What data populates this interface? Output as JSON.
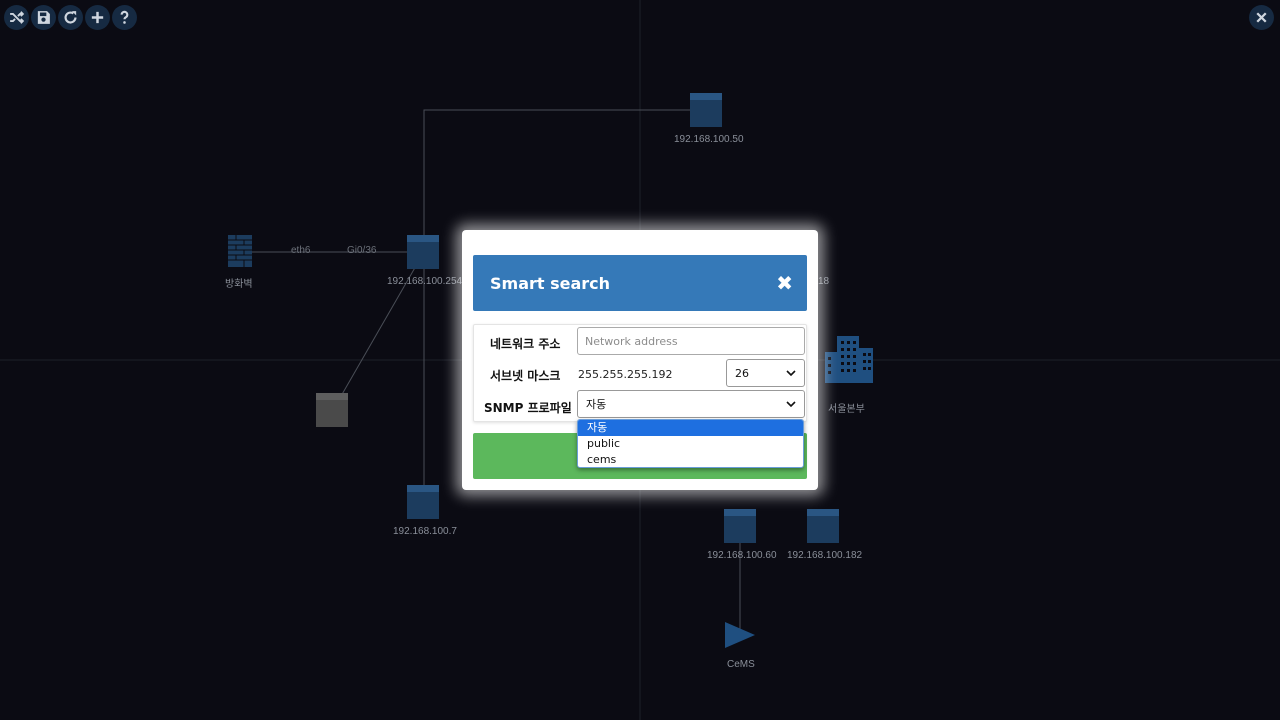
{
  "toolbar": {
    "buttons": [
      {
        "name": "shuffle-icon"
      },
      {
        "name": "save-icon"
      },
      {
        "name": "refresh-icon"
      },
      {
        "name": "plus-icon"
      },
      {
        "name": "help-icon"
      }
    ],
    "close_icon": "close-icon"
  },
  "topology": {
    "nodes": [
      {
        "label": "192.168.100.50",
        "type": "switch"
      },
      {
        "label": "방화벽",
        "type": "firewall"
      },
      {
        "label": "192.168.100.254",
        "type": "switch"
      },
      {
        "label": "18",
        "type": "hidden"
      },
      {
        "label": "",
        "type": "unknown-device"
      },
      {
        "label": "서울본부",
        "type": "building"
      },
      {
        "label": "192.168.100.7",
        "type": "switch"
      },
      {
        "label": "192.168.100.60",
        "type": "switch"
      },
      {
        "label": "192.168.100.182",
        "type": "switch"
      },
      {
        "label": "CeMS",
        "type": "play"
      }
    ],
    "link_labels": {
      "eth": "eth6",
      "gi": "Gi0/36"
    }
  },
  "modal": {
    "title": "Smart search",
    "close_symbol": "✖",
    "network_label": "네트워크 주소",
    "network_placeholder": "Network address",
    "network_value": "",
    "subnet_label": "서브넷 마스크",
    "subnet_mask": "255.255.255.192",
    "prefix_value": "26",
    "snmp_label": "SNMP 프로파일",
    "snmp_value": "자동",
    "snmp_options": [
      "자동",
      "public",
      "cems"
    ]
  },
  "colors": {
    "background": "#0b0b13",
    "header": "#3579b8",
    "button_green": "#5cb85c",
    "node_fill": "#1c3c5e",
    "dropdown_selected": "#1e6fe0"
  }
}
